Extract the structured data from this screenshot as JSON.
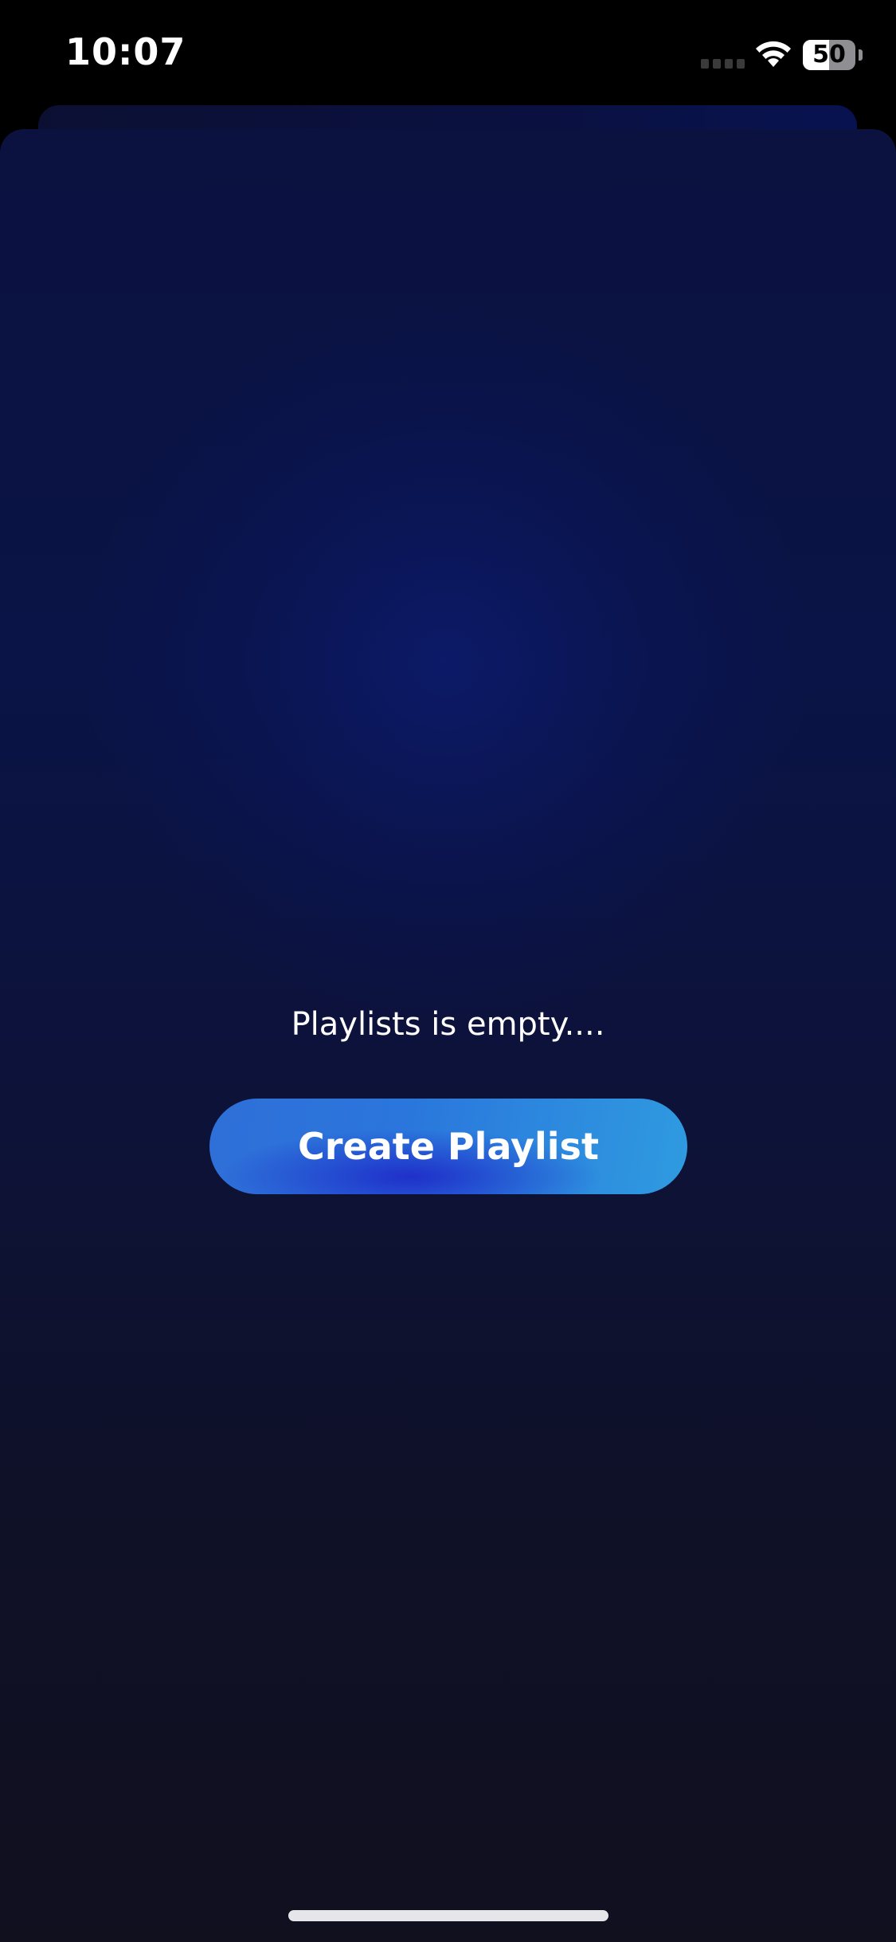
{
  "status_bar": {
    "time": "10:07",
    "battery_level": "50",
    "signal_icon": "cellular-signal-icon",
    "wifi_icon": "wifi-icon",
    "battery_icon": "battery-icon"
  },
  "empty_state": {
    "message": "Playlists is empty....",
    "button_label": "Create Playlist"
  },
  "colors": {
    "background": "#0a1446",
    "button_start": "#2f6fd8",
    "button_end": "#2f9be0",
    "text": "#ffffff"
  }
}
